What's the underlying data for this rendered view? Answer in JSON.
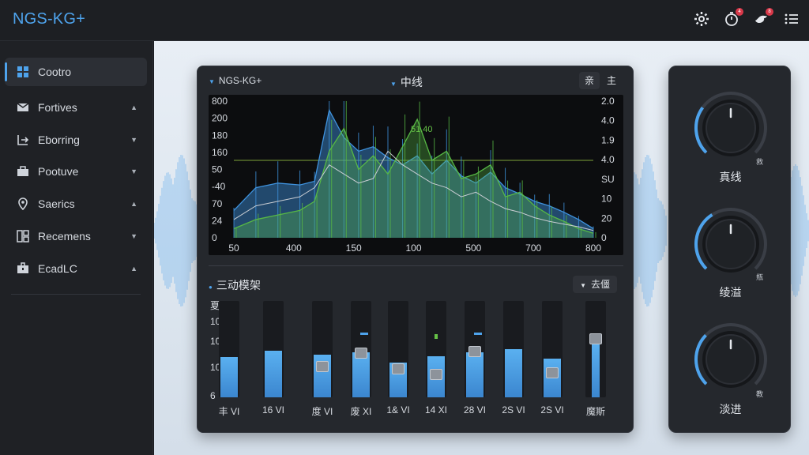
{
  "app": {
    "title": "NGS-KG+"
  },
  "topbar": {
    "icons": [
      {
        "name": "gear-icon",
        "badge": ""
      },
      {
        "name": "timer-icon",
        "badge": "4"
      },
      {
        "name": "bird-icon",
        "badge": "8"
      },
      {
        "name": "menu-icon",
        "badge": ""
      }
    ]
  },
  "sidebar": {
    "items": [
      {
        "label": "Cootro",
        "icon": "grid-icon",
        "chevron": "",
        "active": true
      },
      {
        "label": "Fortives",
        "icon": "mail-icon",
        "chevron": "▲",
        "active": false
      },
      {
        "label": "Eborring",
        "icon": "export-icon",
        "chevron": "▼",
        "active": false
      },
      {
        "label": "Pootuve",
        "icon": "briefcase-icon",
        "chevron": "▼",
        "active": false
      },
      {
        "label": "Saerics",
        "icon": "location-pin-icon",
        "chevron": "▲",
        "active": false
      },
      {
        "label": "Recemens",
        "icon": "layout-icon",
        "chevron": "▼",
        "active": false
      },
      {
        "label": "EcadLC",
        "icon": "case-icon",
        "chevron": "▲",
        "active": false
      }
    ]
  },
  "panel": {
    "left_title": "NGS-KG+",
    "mid_title": "中线",
    "btn_a": "亲",
    "btn_b": "主",
    "peak_label": "51.40"
  },
  "chart_data": {
    "type": "line",
    "y_left_ticks": [
      "800",
      "200",
      "180",
      "160",
      "50",
      "-40",
      "70",
      "24",
      "0"
    ],
    "y_right_ticks": [
      "2.0",
      "4.0",
      "1.9",
      "4.0",
      "SU",
      "10",
      "20",
      "0"
    ],
    "x_ticks": [
      "50",
      "400",
      "150",
      "100",
      "500",
      "700",
      "800"
    ],
    "grid": false,
    "colors": {
      "spectrum": "#3f93df",
      "green": "#57b845",
      "white": "#c9cdd3",
      "baseline": "#7ea33a"
    },
    "series": [
      {
        "x": [
          0,
          30,
          60,
          90,
          110,
          130,
          150,
          170,
          190,
          210,
          230,
          250,
          270,
          290,
          310,
          330,
          350,
          370,
          390,
          410,
          430,
          450,
          470,
          490
        ],
        "values": [
          30,
          55,
          60,
          58,
          62,
          140,
          110,
          95,
          100,
          88,
          80,
          90,
          70,
          85,
          68,
          60,
          72,
          55,
          48,
          40,
          35,
          28,
          20,
          10
        ]
      },
      {
        "x": [
          0,
          30,
          60,
          90,
          110,
          130,
          150,
          170,
          190,
          210,
          230,
          250,
          270,
          290,
          310,
          330,
          350,
          370,
          390,
          410,
          430,
          450,
          470,
          490
        ],
        "values": [
          10,
          20,
          25,
          30,
          40,
          95,
          120,
          75,
          90,
          70,
          100,
          130,
          85,
          95,
          65,
          70,
          80,
          45,
          50,
          35,
          25,
          18,
          10,
          5
        ]
      },
      {
        "x": [
          0,
          30,
          60,
          90,
          110,
          130,
          150,
          170,
          190,
          210,
          230,
          250,
          270,
          290,
          310,
          330,
          350,
          370,
          390,
          410,
          430,
          450,
          470,
          490
        ],
        "values": [
          20,
          35,
          40,
          45,
          55,
          80,
          70,
          60,
          65,
          95,
          80,
          70,
          60,
          55,
          45,
          50,
          40,
          32,
          28,
          22,
          18,
          15,
          12,
          8
        ]
      }
    ],
    "baseline": 85
  },
  "eq": {
    "title": "三动模架",
    "button": "去僵",
    "y_labels": [
      "夏",
      "10",
      "10",
      "10",
      "6"
    ],
    "faders": [
      {
        "label": "丰 VI",
        "level": 0.42,
        "thumb": null,
        "marker": ""
      },
      {
        "label": "16 VI",
        "level": 0.48,
        "thumb": null,
        "marker": ""
      },
      {
        "label": "度 VI",
        "level": 0.44,
        "thumb": 0.26,
        "marker": ""
      },
      {
        "label": "废 XI",
        "level": 0.47,
        "thumb": 0.4,
        "marker": "blue"
      },
      {
        "label": "1& VI",
        "level": 0.36,
        "thumb": 0.24,
        "marker": ""
      },
      {
        "label": "14 XI",
        "level": 0.43,
        "thumb": 0.18,
        "marker": "green"
      },
      {
        "label": "28 VI",
        "level": 0.47,
        "thumb": 0.42,
        "marker": "blue"
      },
      {
        "label": "2S VI",
        "level": 0.5,
        "thumb": null,
        "marker": ""
      },
      {
        "label": "2S VI",
        "level": 0.4,
        "thumb": 0.2,
        "marker": ""
      },
      {
        "label": "魔斯",
        "level": 0.56,
        "thumb": 0.55,
        "marker": ""
      }
    ]
  },
  "knobs": [
    {
      "label": "真线",
      "aux": "救",
      "value": 0.3
    },
    {
      "label": "绫溢",
      "aux": "瓶",
      "value": 0.38
    },
    {
      "label": "淡进",
      "aux": "教",
      "value": 0.33
    }
  ]
}
